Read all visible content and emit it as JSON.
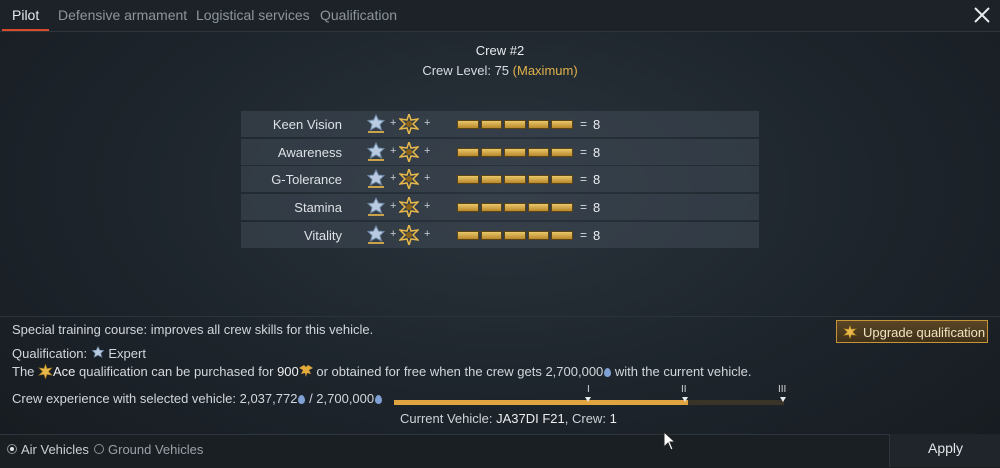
{
  "tabs": [
    "Pilot",
    "Defensive armament",
    "Logistical services",
    "Qualification"
  ],
  "header": {
    "crew_title": "Crew #2",
    "level_label": "Crew Level: ",
    "level_value": "75",
    "level_max": "(Maximum)"
  },
  "skills": [
    {
      "name": "Keen Vision",
      "value": "8"
    },
    {
      "name": "Awareness",
      "value": "8"
    },
    {
      "name": "G-Tolerance",
      "value": "8"
    },
    {
      "name": "Stamina",
      "value": "8"
    },
    {
      "name": "Vitality",
      "value": "8"
    }
  ],
  "skill_bar_segments": 5,
  "skill_symbols": {
    "plus": "+",
    "equals": "="
  },
  "info": {
    "course": "Special training course: improves all crew skills for this vehicle.",
    "qualification_label": "Qualification: ",
    "qualification_value": "Expert",
    "ace_prefix": "The ",
    "ace_name": "Ace",
    "ace_middle": " qualification can be purchased for ",
    "ace_price": "900",
    "ace_rest": " or obtained for free when the crew gets 2,700,000",
    "ace_end": " with the current vehicle.",
    "exp_label": "Crew experience with selected vehicle: 2,037,772",
    "exp_sep": " / 2,700,000"
  },
  "progress": {
    "fraction": 0.754,
    "ticks": [
      "I",
      "II",
      "III"
    ]
  },
  "current_vehicle": {
    "label": "Current Vehicle: ",
    "vehicle": "JA37DI F21",
    "crew_label": ", Crew: ",
    "crew": "1"
  },
  "upgrade_button": "Upgrade qualification",
  "bottom": {
    "radio_air": "Air Vehicles",
    "radio_ground": "Ground Vehicles",
    "apply": "Apply"
  },
  "icons": {
    "close": "close-icon",
    "expert_medal": "expert-medal-icon",
    "ace_medal": "ace-medal-icon",
    "golden_eagle": "golden-eagle-icon",
    "experience_drop": "experience-drop-icon"
  },
  "colors": {
    "accent": "#d84a2a",
    "gold": "#e0b24a",
    "bar": "#e0a440"
  }
}
